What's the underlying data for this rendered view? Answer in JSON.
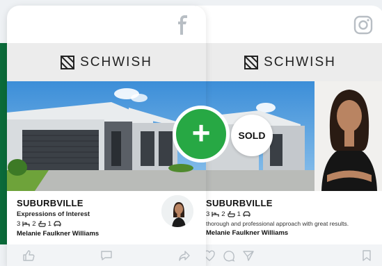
{
  "colors": {
    "accent": "#27a844",
    "edge": "#0b6b3a",
    "brand_bar": "#ececec"
  },
  "facebook_card": {
    "platform_icon": "facebook-icon",
    "brand": "SCHWISH",
    "title": "SUBURBVILLE",
    "subtitle": "Expressions of Interest",
    "specs": {
      "beds": "3",
      "baths": "2",
      "cars": "1"
    },
    "agent": "Melanie Faulkner Williams",
    "actions": [
      "like-icon",
      "comment-icon",
      "share-icon"
    ]
  },
  "instagram_card": {
    "platform_icon": "instagram-icon",
    "brand": "SCHWISH",
    "badge": "SOLD",
    "title": "SUBURBVILLE",
    "specs": {
      "beds": "3",
      "baths": "2",
      "cars": "1"
    },
    "description": "thorough and professional approach with great results.",
    "agent": "Melanie Faulkner Williams",
    "actions": [
      "heart-icon",
      "comment-icon",
      "send-icon",
      "bookmark-icon"
    ]
  },
  "add_button": {
    "label": "+"
  }
}
